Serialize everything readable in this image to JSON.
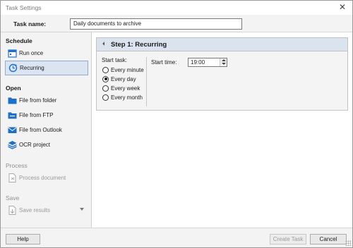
{
  "window": {
    "title": "Task Settings",
    "close_glyph": "✕"
  },
  "task_name": {
    "label": "Task name:",
    "value": "Daily documents to archive"
  },
  "sidebar": {
    "schedule": {
      "title": "Schedule",
      "items": [
        {
          "label": "Run once",
          "icon": "calendar-icon"
        },
        {
          "label": "Recurring",
          "icon": "recurring-icon",
          "selected": true
        }
      ]
    },
    "open": {
      "title": "Open",
      "items": [
        {
          "label": "File from folder",
          "icon": "folder-icon"
        },
        {
          "label": "File from FTP",
          "icon": "ftp-folder-icon"
        },
        {
          "label": "File from Outlook",
          "icon": "mail-icon"
        },
        {
          "label": "OCR project",
          "icon": "layers-icon"
        }
      ]
    },
    "process": {
      "title": "Process",
      "items": [
        {
          "label": "Process document",
          "icon": "process-document-icon",
          "disabled": true
        }
      ]
    },
    "save": {
      "title": "Save",
      "items": [
        {
          "label": "Save results",
          "icon": "save-results-icon",
          "disabled": true
        }
      ]
    }
  },
  "step": {
    "title": "Step 1: Recurring",
    "start_task_label": "Start task:",
    "options": [
      "Every minute",
      "Every day",
      "Every week",
      "Every month"
    ],
    "selected_option": "Every day",
    "start_time_label": "Start time:",
    "start_time_value": "19:00"
  },
  "footer": {
    "help": "Help",
    "create_task": "Create Task",
    "cancel": "Cancel"
  },
  "colors": {
    "accent_blue": "#1e6fc7",
    "selected_bg": "#dbe5f2",
    "panel_header": "#dbe3ee"
  }
}
